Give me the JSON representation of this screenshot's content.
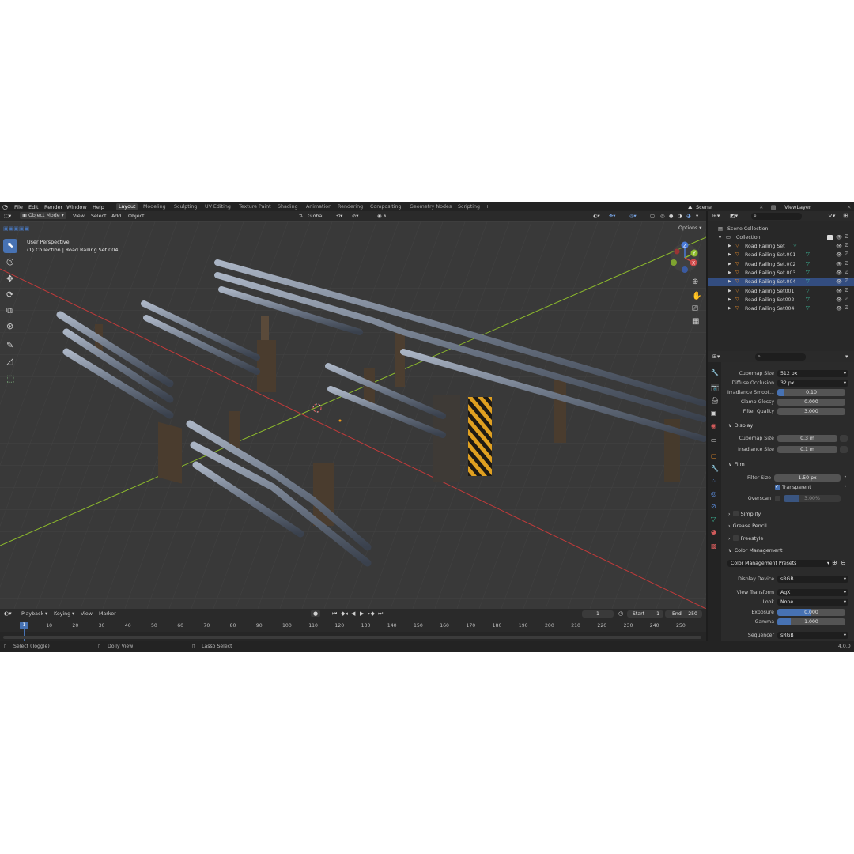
{
  "menu": [
    "File",
    "Edit",
    "Render",
    "Window",
    "Help"
  ],
  "workspaces": [
    "Layout",
    "Modeling",
    "Sculpting",
    "UV Editing",
    "Texture Paint",
    "Shading",
    "Animation",
    "Rendering",
    "Compositing",
    "Geometry Nodes",
    "Scripting"
  ],
  "workspace_add": "+",
  "scene": "Scene",
  "view_layer": "ViewLayer",
  "viewport_header": {
    "mode": "Object Mode",
    "view": "View",
    "select": "Select",
    "add": "Add",
    "object": "Object",
    "orientation": "Global",
    "options": "Options"
  },
  "viewport": {
    "perspective": "User Perspective",
    "collection_info": "(1) Collection | Road Railing Set.004",
    "gizmo_axes": [
      "Z",
      "Y",
      "X"
    ]
  },
  "outliner": {
    "root": "Scene Collection",
    "collection": "Collection",
    "objects": [
      "Road Railing Set",
      "Road Railing Set.001",
      "Road Railing Set.002",
      "Road Railing Set.003",
      "Road Railing Set.004",
      "Road Railing Set001",
      "Road Railing Set002",
      "Road Railing Set004"
    ],
    "selected_index": 4
  },
  "properties": {
    "cubemap_size_label": "Cubemap Size",
    "cubemap_size": "512 px",
    "diffuse_occlusion_label": "Diffuse Occlusion",
    "diffuse_occlusion": "32 px",
    "irradiance_smooth_label": "Irradiance Smoot...",
    "irradiance_smooth": "0.10",
    "clamp_glossy_label": "Clamp Glossy",
    "clamp_glossy": "0.000",
    "filter_quality_label": "Filter Quality",
    "filter_quality": "3.000",
    "display_section": "Display",
    "display_cubemap_label": "Cubemap Size",
    "display_cubemap": "0.3 m",
    "irradiance_size_label": "Irradiance Size",
    "irradiance_size": "0.1 m",
    "film_section": "Film",
    "filter_size_label": "Filter Size",
    "filter_size": "1.50 px",
    "transparent_label": "Transparent",
    "overscan_label": "Overscan",
    "overscan": "3.00%",
    "simplify_section": "Simplify",
    "grease_pencil_section": "Grease Pencil",
    "freestyle_section": "Freestyle",
    "color_management_section": "Color Management",
    "color_presets": "Color Management Presets",
    "display_device_label": "Display Device",
    "display_device": "sRGB",
    "view_transform_label": "View Transform",
    "view_transform": "AgX",
    "look_label": "Look",
    "look": "None",
    "exposure_label": "Exposure",
    "exposure": "0.000",
    "gamma_label": "Gamma",
    "gamma": "1.000",
    "sequencer_label": "Sequencer",
    "sequencer": "sRGB"
  },
  "timeline": {
    "playback": "Playback",
    "keying": "Keying",
    "view": "View",
    "marker": "Marker",
    "current_frame": "1",
    "start_label": "Start",
    "start": "1",
    "end_label": "End",
    "end": "250",
    "frame_marker": "1",
    "ticks": [
      "10",
      "20",
      "30",
      "40",
      "50",
      "60",
      "70",
      "80",
      "90",
      "100",
      "110",
      "120",
      "130",
      "140",
      "150",
      "160",
      "170",
      "180",
      "190",
      "200",
      "210",
      "220",
      "230",
      "240",
      "250"
    ]
  },
  "statusbar": {
    "select": "Select (Toggle)",
    "dolly": "Dolly View",
    "lasso": "Lasso Select",
    "version": "4.0.0"
  },
  "colors": {
    "accent": "#4772b3",
    "x_axis": "#c23a3a",
    "y_axis": "#8dbb2c",
    "hazard": "#e0a020"
  }
}
